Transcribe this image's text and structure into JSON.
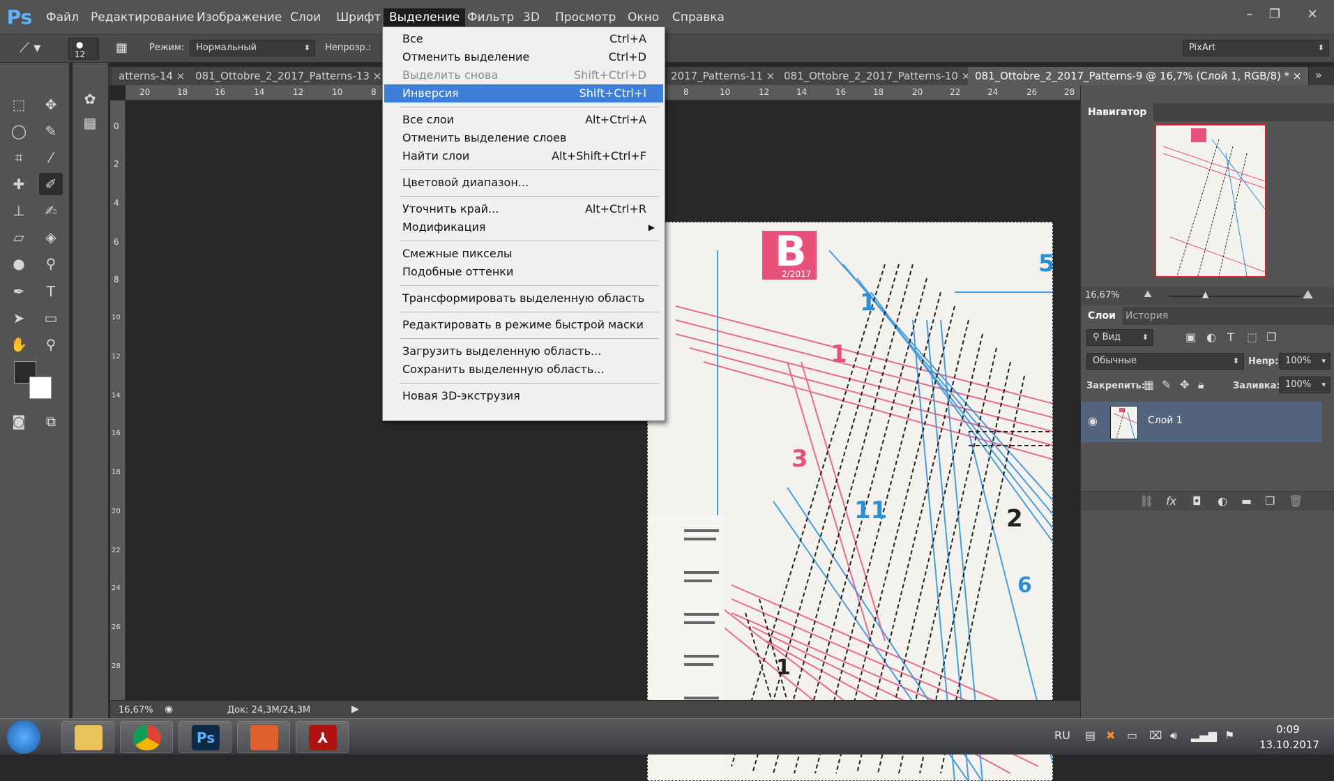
{
  "app": {
    "logo": "Ps"
  },
  "menubar": {
    "items": [
      "Файл",
      "Редактирование",
      "Изображение",
      "Слои",
      "Шрифт",
      "Выделение",
      "Фильтр",
      "3D",
      "Просмотр",
      "Окно",
      "Справка"
    ],
    "active": "Выделение",
    "window_controls": {
      "minimize": "–",
      "restore": "❐",
      "close": "✕"
    }
  },
  "options": {
    "brush_size": "12",
    "mode_label": "Режим:",
    "mode_value": "Нормальный",
    "opacity_label": "Непрозр.:",
    "workspace_value": "PixArt"
  },
  "tabs": [
    {
      "label": "atterns-14",
      "close": "×",
      "active": false
    },
    {
      "label": "081_Ottobre_2_2017_Patterns-13",
      "close": "×",
      "active": false
    },
    {
      "label": "2017_Patterns-11",
      "close": "×",
      "active": false
    },
    {
      "label": "081_Ottobre_2_2017_Patterns-10",
      "close": "×",
      "active": false
    },
    {
      "label": "081_Ottobre_2_2017_Patterns-9 @ 16,7% (Слой 1, RGB/8) *",
      "close": "×",
      "active": true
    }
  ],
  "tabs_overflow": "»",
  "ruler_top_left": [
    "20",
    "18",
    "16",
    "14",
    "12",
    "10",
    "8"
  ],
  "ruler_top_right": [
    "8",
    "10",
    "12",
    "14",
    "16",
    "18",
    "20",
    "22",
    "24",
    "26",
    "28"
  ],
  "ruler_left": [
    "0",
    "2",
    "4",
    "6",
    "8",
    "10",
    "12",
    "14",
    "16",
    "18",
    "20",
    "22",
    "24",
    "26",
    "28"
  ],
  "select_menu": {
    "items": [
      {
        "label": "Все",
        "shortcut": "Ctrl+A",
        "disabled": false
      },
      {
        "label": "Отменить выделение",
        "shortcut": "Ctrl+D",
        "disabled": false
      },
      {
        "label": "Выделить снова",
        "shortcut": "Shift+Ctrl+D",
        "disabled": true
      },
      {
        "label": "Инверсия",
        "shortcut": "Shift+Ctrl+I",
        "highlighted": true
      },
      {
        "label": "Все слои",
        "shortcut": "Alt+Ctrl+A"
      },
      {
        "label": "Отменить выделение слоев",
        "shortcut": ""
      },
      {
        "label": "Найти слои",
        "shortcut": "Alt+Shift+Ctrl+F"
      },
      {
        "label": "Цветовой диапазон...",
        "shortcut": ""
      },
      {
        "label": "Уточнить край...",
        "shortcut": "Alt+Ctrl+R"
      },
      {
        "label": "Модификация",
        "shortcut": "",
        "submenu": "▶"
      },
      {
        "label": "Смежные пикселы",
        "shortcut": ""
      },
      {
        "label": "Подобные оттенки",
        "shortcut": ""
      },
      {
        "label": "Трансформировать выделенную область",
        "shortcut": ""
      },
      {
        "label": "Редактировать в режиме быстрой маски",
        "shortcut": ""
      },
      {
        "label": "Загрузить выделенную область...",
        "shortcut": ""
      },
      {
        "label": "Сохранить выделенную область...",
        "shortcut": ""
      },
      {
        "label": "Новая 3D-экструзия",
        "shortcut": ""
      }
    ]
  },
  "document": {
    "big_letter": "B",
    "issue": "2/2017",
    "numbers": [
      "1",
      "1",
      "5",
      "3",
      "11",
      "2",
      "6",
      "1"
    ]
  },
  "status": {
    "zoom": "16,67%",
    "doc": "Док: 24,3M/24,3M"
  },
  "navigator": {
    "title": "Навигатор",
    "zoom": "16,67%"
  },
  "layers_panel": {
    "tabs": [
      "Слои",
      "История"
    ],
    "filter_label": "Вид",
    "blend_mode": "Обычные",
    "opacity_label": "Непр:",
    "opacity_value": "100%",
    "lock_label": "Закрепить:",
    "fill_label": "Заливка:",
    "fill_value": "100%",
    "layer_name": "Слой 1"
  },
  "taskbar": {
    "lang": "RU",
    "time": "0:09",
    "date": "13.10.2017"
  },
  "colors": {
    "menu_highlight": "#3d7fd6",
    "pattern_pink": "#e8527a",
    "pattern_blue": "#2b8fd6"
  }
}
